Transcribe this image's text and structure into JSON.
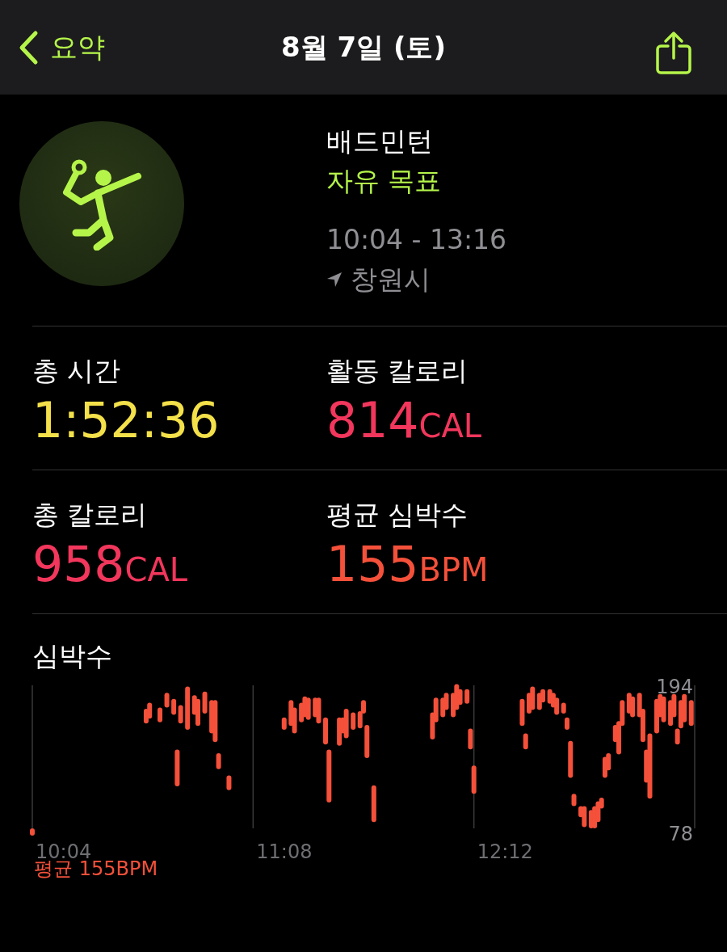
{
  "nav": {
    "back_label": "요약",
    "title": "8월 7일 (토)"
  },
  "workout": {
    "name": "배드민턴",
    "goal": "자유 목표",
    "time_range": "10:04 - 13:16",
    "location": "창원시"
  },
  "stats": [
    {
      "label": "총 시간",
      "value": "1:52:36",
      "color": "#f4e14a"
    },
    {
      "label": "활동 칼로리",
      "value": "814",
      "unit": "CAL",
      "color": "#f2365c"
    },
    {
      "label": "총 칼로리",
      "value": "958",
      "unit": "CAL",
      "color": "#f2365c"
    },
    {
      "label": "평균 심박수",
      "value": "155",
      "unit": "BPM",
      "color": "#f4503a"
    }
  ],
  "heart_rate": {
    "title": "심박수",
    "scale_labels": [
      "194",
      "78"
    ],
    "time_labels": [
      "10:04",
      "11:08",
      "12:12"
    ],
    "average": "평균 155BPM"
  }
}
